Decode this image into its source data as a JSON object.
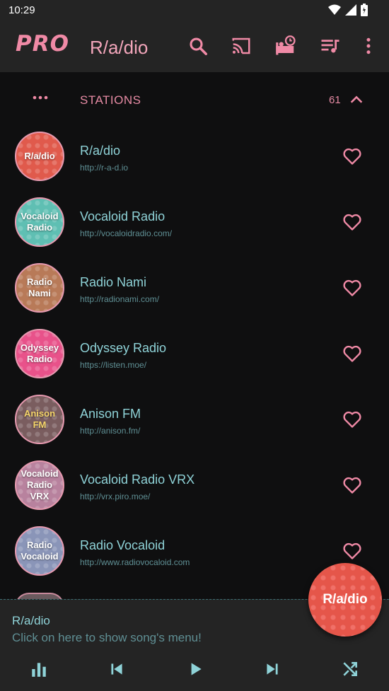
{
  "status_bar": {
    "time": "10:29"
  },
  "app_bar": {
    "logo": "PRO",
    "title": "R/a/dio"
  },
  "section": {
    "label": "STATIONS",
    "count": "61"
  },
  "stations": [
    {
      "avatar_text": "R/a/dio",
      "name": "R/a/dio",
      "url": "http://r-a-d.io",
      "color": "#e05a4c"
    },
    {
      "avatar_text": "Vocaloid Radio",
      "name": "Vocaloid Radio",
      "url": "http://vocaloidradio.com/",
      "color": "#5fbfb3"
    },
    {
      "avatar_text": "Radio Nami",
      "name": "Radio Nami",
      "url": "http://radionami.com/",
      "color": "#b87a58"
    },
    {
      "avatar_text": "Odyssey Radio",
      "name": "Odyssey Radio",
      "url": "https://listen.moe/",
      "color": "#e8528a"
    },
    {
      "avatar_text": "Anison FM",
      "name": "Anison FM",
      "url": "http://anison.fm/",
      "color": "#7a5d5f"
    },
    {
      "avatar_text": "Vocaloid Radio VRX",
      "name": "Vocaloid Radio VRX",
      "url": "http://vrx.piro.moe/",
      "color": "#b8829e"
    },
    {
      "avatar_text": "Radio Vocaloid",
      "name": "Radio Vocaloid",
      "url": "http://www.radiovocaloid.com",
      "color": "#8a95b8"
    }
  ],
  "player": {
    "title": "R/a/dio",
    "subtitle": "Click on here to show song's menu!",
    "fab_text": "R/a/dio"
  },
  "colors": {
    "accent": "#f08aa6",
    "teal": "#8fd3d8",
    "bar": "#242424",
    "background": "#0f0f10"
  }
}
